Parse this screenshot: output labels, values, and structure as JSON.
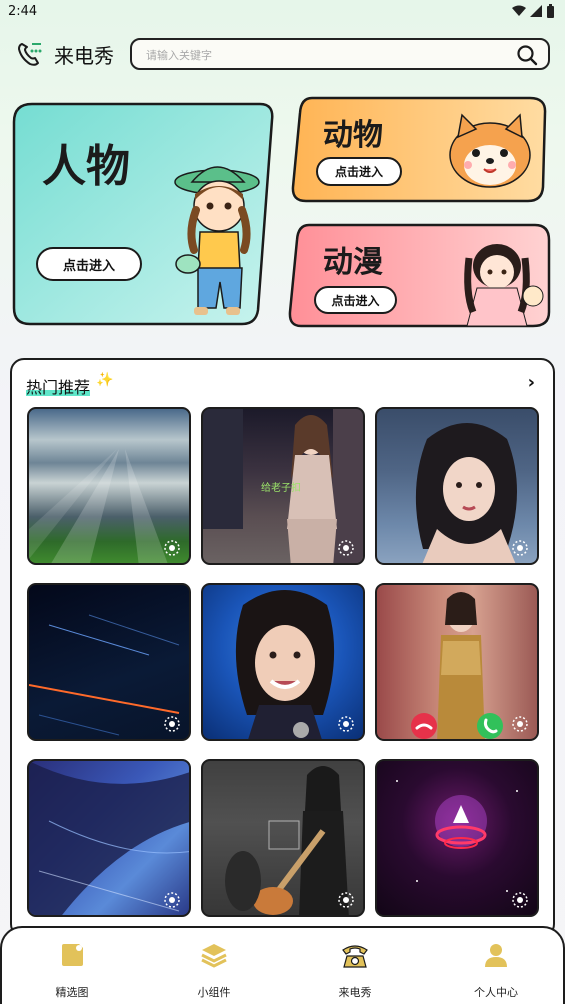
{
  "status": {
    "time": "2:44"
  },
  "header": {
    "title": "来电秀",
    "search_placeholder": "请输入关键字"
  },
  "categories": [
    {
      "id": "people",
      "title": "人物",
      "button": "点击进入",
      "color": "#8fe6dc"
    },
    {
      "id": "animals",
      "title": "动物",
      "button": "点击进入",
      "color": "#ffc86e"
    },
    {
      "id": "anime",
      "title": "动漫",
      "button": "点击进入",
      "color": "#ff9aa0"
    }
  ],
  "hot": {
    "title": "热门推荐",
    "sparkle": "✨",
    "more": "›",
    "tiles": [
      {
        "name": "clouds-sunbeams"
      },
      {
        "name": "game-girl-street",
        "caption": "给老子扣"
      },
      {
        "name": "woman-portrait-night"
      },
      {
        "name": "light-streaks"
      },
      {
        "name": "woman-smiling-stage"
      },
      {
        "name": "woman-gold-dress-call"
      },
      {
        "name": "anime-hair-blue"
      },
      {
        "name": "guitarist-stage"
      },
      {
        "name": "glowing-ufo-space"
      }
    ]
  },
  "nav": [
    {
      "label": "精选图",
      "icon": "gallery-icon"
    },
    {
      "label": "小组件",
      "icon": "layers-icon"
    },
    {
      "label": "来电秀",
      "icon": "phone-icon"
    },
    {
      "label": "个人中心",
      "icon": "user-icon"
    }
  ]
}
